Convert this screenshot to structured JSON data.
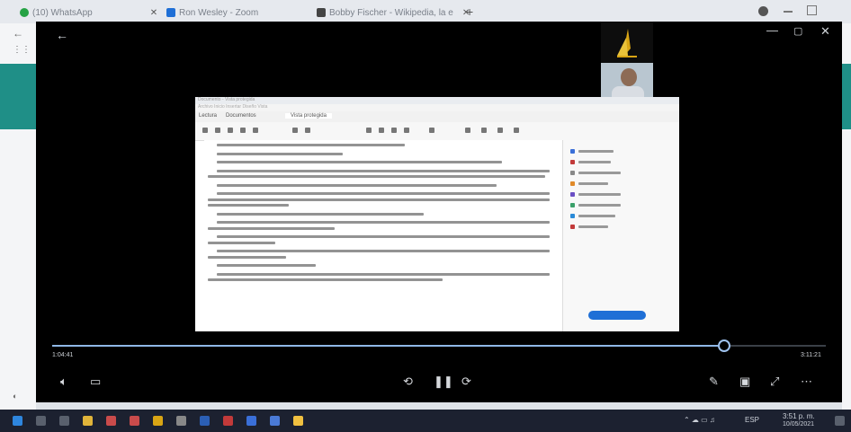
{
  "tabs": [
    {
      "label": "(10) WhatsApp",
      "color": "#25a244"
    },
    {
      "label": "Ron Wesley - Zoom",
      "color": "#1f6fd6"
    },
    {
      "label": "Bobby Fischer - Wikipedia, la e",
      "color": "#444444"
    }
  ],
  "player": {
    "elapsed": "1:04:41",
    "total": "3:11:21",
    "progress": 0.86
  },
  "document": {
    "title": "Documento - Vista protegida",
    "menu": "Archivo  Inicio  Insertar  Diseño  Vista",
    "tab_left": "Lectura",
    "tab_mid": "Documentos",
    "tab_active": "Vista protegida",
    "paragraphs": [
      "—Dice que es un gran rey ¿Y qué es lo que haces aquí?",
      "—¿Y las estrellas te obedecen?",
      "—Naturalmente —le dijo el rey—. Y obedecen en seguida, pues yo no tolero la indisciplina.",
      "Un poder semejante dejó maravillado al principito. Si él hubiera tenido tal poder, habría podido asistir no a cuarenta y cuatro, sino a setenta y dos, o incluso a cien, o a doscientas puestas de sol en el mismo día.",
      "—Me gustaría ver una puesta de sol... Deme ese gusto... Ordénele al sol que se ponga...",
      "—Si yo le diera a un general la orden de volar de flor en flor como una mariposa, o de escribir una tragedia, o de transformarse en ave marina, y si el general no ejecutase la orden recibida, ¿de quién sería la culpa, mía o de él?",
      "—La culpa sería de usted —le dijo el principito con firmeza.",
      "—Exactamente. Sólo hay que pedir a cada uno lo que cada uno puede dar —continuó el rey. La autoridad se apoya antes que nada en la razón.",
      "—¿Entonces mi puesta de sol? —recordó el principito, que jamás olvidaba su pregunta una vez que la había formulado.",
      "—Tendrás tu puesta de sol. La exigiré. Pero, según mi ciencia gobernante, esperaré que las condiciones sean favorables.",
      "—¿Y cuándo será eso?",
      "—¡Hem! ¡Hem! —le respondió el rey—, consultando previamente un enorme calendario—. ¡Hem! ¡Hem! Será hacia... hacia... será hacia las siete cuarenta. Ya verás cómo se me obedece."
    ],
    "pane_items": [
      "Exportar PDF",
      "Editar PDF",
      "Crear archivo PDF",
      "Comentar",
      "Combinar archivos",
      "Organizar páginas",
      "Comprimir PDF",
      "Redactar"
    ],
    "pane_button": "Prueba gratis"
  },
  "tray": {
    "time": "3:51 p. m.",
    "date": "10/05/2021",
    "lang": "ESP"
  }
}
